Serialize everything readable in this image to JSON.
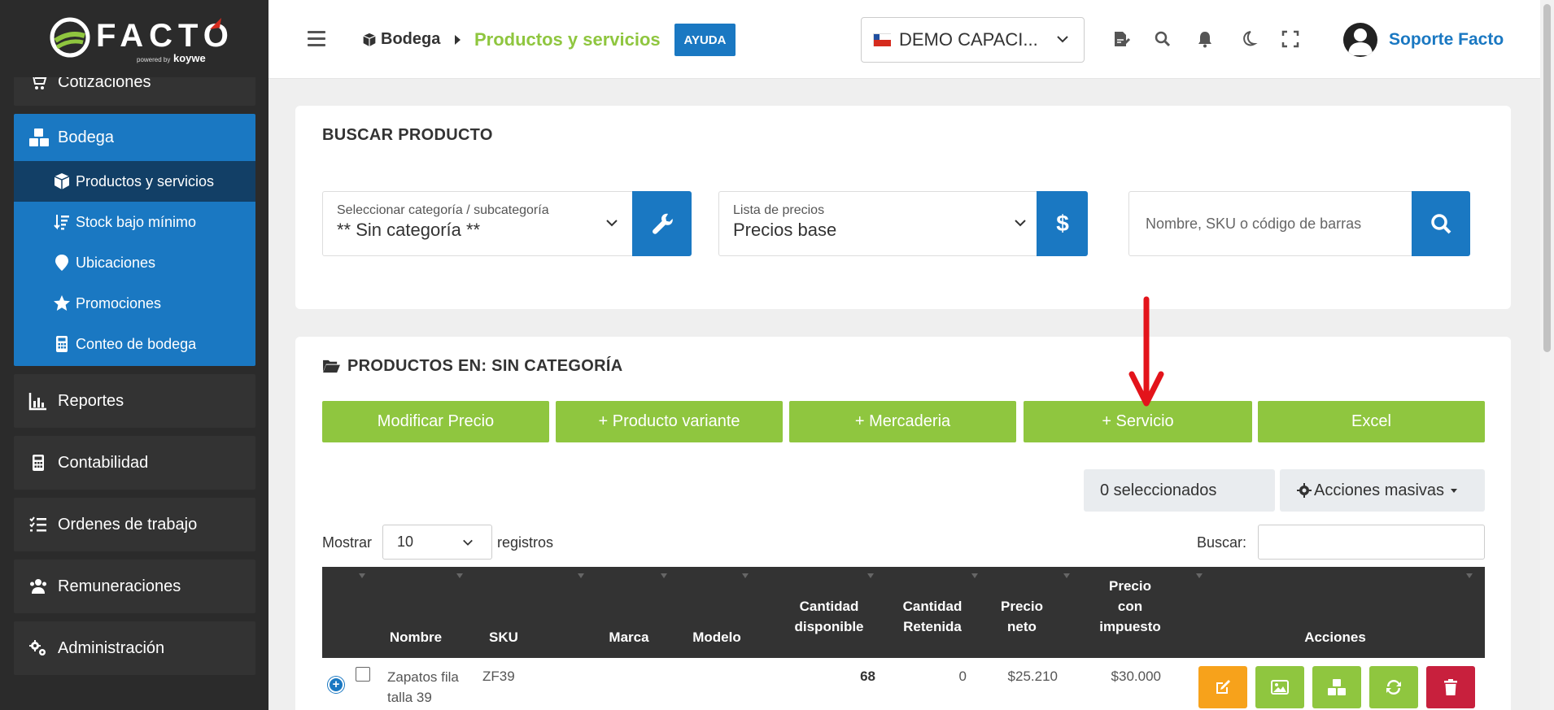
{
  "logo": {
    "word": "FACTO",
    "powered": "powered by",
    "brand": "koywe"
  },
  "sidebar": {
    "partial_item": "Cotizaciones",
    "bodega": "Bodega",
    "bodega_items": [
      {
        "label": "Productos y servicios",
        "icon": "box-icon"
      },
      {
        "label": "Stock bajo mínimo",
        "icon": "sort-amount-icon"
      },
      {
        "label": "Ubicaciones",
        "icon": "map-marker-icon"
      },
      {
        "label": "Promociones",
        "icon": "star-icon"
      },
      {
        "label": "Conteo de bodega",
        "icon": "calculator-icon"
      }
    ],
    "items": [
      {
        "label": "Reportes",
        "icon": "chart-icon"
      },
      {
        "label": "Contabilidad",
        "icon": "calculator-icon"
      },
      {
        "label": "Ordenes de trabajo",
        "icon": "list-check-icon"
      },
      {
        "label": "Remuneraciones",
        "icon": "users-icon"
      },
      {
        "label": "Administración",
        "icon": "cogs-icon"
      }
    ]
  },
  "header": {
    "crumb1": "Bodega",
    "crumb2": "Productos y servicios",
    "help": "AYUDA",
    "company": "DEMO CAPACI...",
    "user": "Soporte Facto"
  },
  "search": {
    "title": "BUSCAR PRODUCTO",
    "category_label": "Seleccionar categoría / subcategoría",
    "category_value": "** Sin categoría **",
    "pricelist_label": "Lista de precios",
    "pricelist_value": "Precios base",
    "query_placeholder": "Nombre, SKU o código de barras"
  },
  "products": {
    "title": "PRODUCTOS EN: SIN CATEGORÍA",
    "buttons": [
      "Modificar Precio",
      "+ Producto variante",
      "+ Mercaderia",
      "+ Servicio",
      "Excel"
    ],
    "selected": "0 seleccionados",
    "mass_actions": "Acciones masivas",
    "show_label": "Mostrar",
    "page_size": "10",
    "records_label": "registros",
    "search_label": "Buscar:",
    "columns": {
      "nombre": "Nombre",
      "sku": "SKU",
      "marca": "Marca",
      "modelo": "Modelo",
      "disp1": "Cantidad",
      "disp2": "disponible",
      "ret1": "Cantidad",
      "ret2": "Retenida",
      "neto1": "Precio",
      "neto2": "neto",
      "imp1": "Precio",
      "imp2": "con",
      "imp3": "impuesto",
      "acciones": "Acciones"
    },
    "rows": [
      {
        "nombre_l1": "Zapatos fila",
        "nombre_l2": "talla 39",
        "sku": "ZF39",
        "marca": "",
        "modelo": "",
        "disponible": "68",
        "retenida": "0",
        "neto": "$25.210",
        "impuesto": "$30.000"
      }
    ]
  },
  "colors": {
    "primary": "#1a78c2",
    "green": "#8fc63f",
    "sidebar": "#2b2b2b",
    "warning": "#f7a21b",
    "danger": "#c8203d"
  }
}
